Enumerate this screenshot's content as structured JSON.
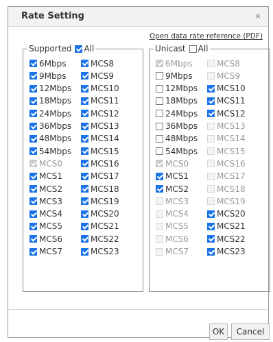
{
  "dialog": {
    "title": "Rate Setting",
    "close_glyph": "×",
    "reference_link": "Open data rate reference (PDF)",
    "ok_label": "OK",
    "cancel_label": "Cancel"
  },
  "supported": {
    "legend": "Supported",
    "all_label": "All",
    "all_checked": true,
    "left_column": [
      {
        "label": "6Mbps",
        "checked": true,
        "disabled": false
      },
      {
        "label": "9Mbps",
        "checked": true,
        "disabled": false
      },
      {
        "label": "12Mbps",
        "checked": true,
        "disabled": false
      },
      {
        "label": "18Mbps",
        "checked": true,
        "disabled": false
      },
      {
        "label": "24Mbps",
        "checked": true,
        "disabled": false
      },
      {
        "label": "36Mbps",
        "checked": true,
        "disabled": false
      },
      {
        "label": "48Mbps",
        "checked": true,
        "disabled": false
      },
      {
        "label": "54Mbps",
        "checked": true,
        "disabled": false
      },
      {
        "label": "MCS0",
        "checked": true,
        "disabled": true
      },
      {
        "label": "MCS1",
        "checked": true,
        "disabled": false
      },
      {
        "label": "MCS2",
        "checked": true,
        "disabled": false
      },
      {
        "label": "MCS3",
        "checked": true,
        "disabled": false
      },
      {
        "label": "MCS4",
        "checked": true,
        "disabled": false
      },
      {
        "label": "MCS5",
        "checked": true,
        "disabled": false
      },
      {
        "label": "MCS6",
        "checked": true,
        "disabled": false
      },
      {
        "label": "MCS7",
        "checked": true,
        "disabled": false
      }
    ],
    "right_column": [
      {
        "label": "MCS8",
        "checked": true,
        "disabled": false
      },
      {
        "label": "MCS9",
        "checked": true,
        "disabled": false
      },
      {
        "label": "MCS10",
        "checked": true,
        "disabled": false
      },
      {
        "label": "MCS11",
        "checked": true,
        "disabled": false
      },
      {
        "label": "MCS12",
        "checked": true,
        "disabled": false
      },
      {
        "label": "MCS13",
        "checked": true,
        "disabled": false
      },
      {
        "label": "MCS14",
        "checked": true,
        "disabled": false
      },
      {
        "label": "MCS15",
        "checked": true,
        "disabled": false
      },
      {
        "label": "MCS16",
        "checked": true,
        "disabled": false
      },
      {
        "label": "MCS17",
        "checked": true,
        "disabled": false
      },
      {
        "label": "MCS18",
        "checked": true,
        "disabled": false
      },
      {
        "label": "MCS19",
        "checked": true,
        "disabled": false
      },
      {
        "label": "MCS20",
        "checked": true,
        "disabled": false
      },
      {
        "label": "MCS21",
        "checked": true,
        "disabled": false
      },
      {
        "label": "MCS22",
        "checked": true,
        "disabled": false
      },
      {
        "label": "MCS23",
        "checked": true,
        "disabled": false
      }
    ]
  },
  "unicast": {
    "legend": "Unicast",
    "all_label": "All",
    "all_checked": false,
    "left_column": [
      {
        "label": "6Mbps",
        "checked": true,
        "disabled": true
      },
      {
        "label": "9Mbps",
        "checked": false,
        "disabled": false
      },
      {
        "label": "12Mbps",
        "checked": false,
        "disabled": false
      },
      {
        "label": "18Mbps",
        "checked": false,
        "disabled": false
      },
      {
        "label": "24Mbps",
        "checked": false,
        "disabled": false
      },
      {
        "label": "36Mbps",
        "checked": false,
        "disabled": false
      },
      {
        "label": "48Mbps",
        "checked": false,
        "disabled": false
      },
      {
        "label": "54Mbps",
        "checked": false,
        "disabled": false
      },
      {
        "label": "MCS0",
        "checked": true,
        "disabled": true
      },
      {
        "label": "MCS1",
        "checked": true,
        "disabled": false
      },
      {
        "label": "MCS2",
        "checked": true,
        "disabled": false
      },
      {
        "label": "MCS3",
        "checked": false,
        "disabled": true
      },
      {
        "label": "MCS4",
        "checked": false,
        "disabled": true
      },
      {
        "label": "MCS5",
        "checked": false,
        "disabled": true
      },
      {
        "label": "MCS6",
        "checked": false,
        "disabled": true
      },
      {
        "label": "MCS7",
        "checked": false,
        "disabled": true
      }
    ],
    "right_column": [
      {
        "label": "MCS8",
        "checked": false,
        "disabled": true
      },
      {
        "label": "MCS9",
        "checked": false,
        "disabled": true
      },
      {
        "label": "MCS10",
        "checked": true,
        "disabled": false
      },
      {
        "label": "MCS11",
        "checked": true,
        "disabled": false
      },
      {
        "label": "MCS12",
        "checked": true,
        "disabled": false
      },
      {
        "label": "MCS13",
        "checked": false,
        "disabled": true
      },
      {
        "label": "MCS14",
        "checked": false,
        "disabled": true
      },
      {
        "label": "MCS15",
        "checked": false,
        "disabled": true
      },
      {
        "label": "MCS16",
        "checked": false,
        "disabled": true
      },
      {
        "label": "MCS17",
        "checked": false,
        "disabled": true
      },
      {
        "label": "MCS18",
        "checked": false,
        "disabled": true
      },
      {
        "label": "MCS19",
        "checked": false,
        "disabled": true
      },
      {
        "label": "MCS20",
        "checked": true,
        "disabled": false
      },
      {
        "label": "MCS21",
        "checked": true,
        "disabled": false
      },
      {
        "label": "MCS22",
        "checked": true,
        "disabled": false
      },
      {
        "label": "MCS23",
        "checked": true,
        "disabled": false
      }
    ]
  }
}
